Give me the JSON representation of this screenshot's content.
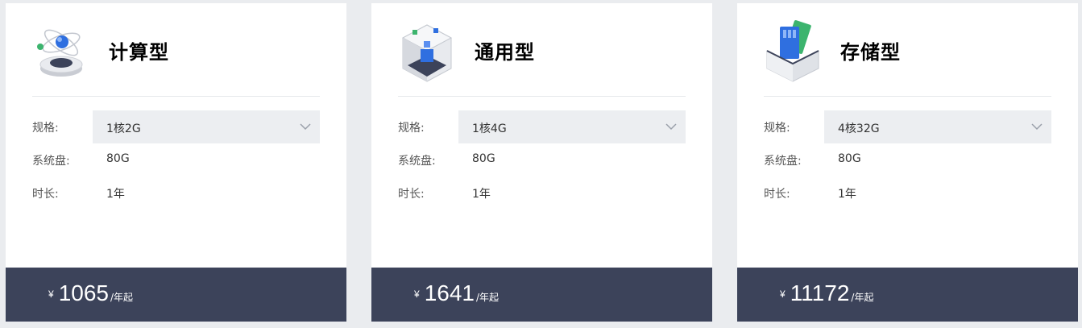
{
  "cards": [
    {
      "title": "计算型",
      "icon": "compute-orbit-icon",
      "spec_label": "规格:",
      "spec_value": "1核2G",
      "disk_label": "系统盘:",
      "disk_value": "80G",
      "duration_label": "时长:",
      "duration_value": "1年",
      "currency": "¥",
      "price": "1065",
      "price_unit": "/年起"
    },
    {
      "title": "通用型",
      "icon": "general-cube-icon",
      "spec_label": "规格:",
      "spec_value": "1核4G",
      "disk_label": "系统盘:",
      "disk_value": "80G",
      "duration_label": "时长:",
      "duration_value": "1年",
      "currency": "¥",
      "price": "1641",
      "price_unit": "/年起"
    },
    {
      "title": "存储型",
      "icon": "storage-card-icon",
      "spec_label": "规格:",
      "spec_value": "4核32G",
      "disk_label": "系统盘:",
      "disk_value": "80G",
      "duration_label": "时长:",
      "duration_value": "1年",
      "currency": "¥",
      "price": "11172",
      "price_unit": "/年起"
    }
  ],
  "colors": {
    "background": "#eaecef",
    "card": "#ffffff",
    "select_bg": "#eceef1",
    "price_bar": "#3c435a",
    "blue_accent": "#2f6fe0",
    "green_accent": "#3cb46e"
  }
}
